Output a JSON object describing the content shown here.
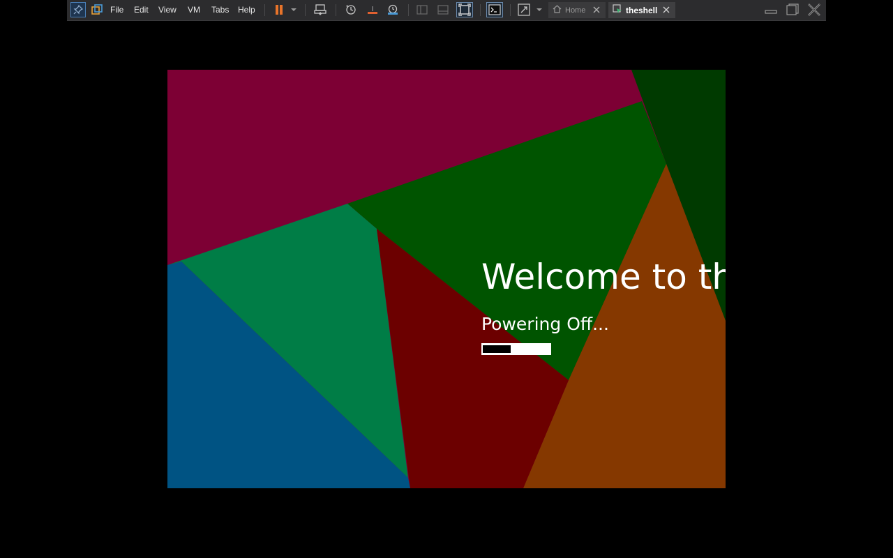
{
  "menu": {
    "file": "File",
    "edit": "Edit",
    "view": "View",
    "vm": "VM",
    "tabs": "Tabs",
    "help": "Help"
  },
  "icons": {
    "pin": "pin-icon",
    "library": "library-icon",
    "pause": "pause-icon",
    "send_keys": "send-ctrl-alt-del-icon",
    "snapshot": "snapshot-icon",
    "revert": "revert-snapshot-icon",
    "manage_snapshots": "snapshot-manager-icon",
    "console": "console-view-icon",
    "fullscreen": "fullscreen-icon"
  },
  "tabs": [
    {
      "label": "Home",
      "active": false
    },
    {
      "label": "theshell",
      "active": true
    }
  ],
  "vm_screen": {
    "welcome_text": "Welcome to th",
    "status_text": "Powering Off...",
    "progress_percent": 42
  },
  "colors": {
    "pause_accent": "#e8742a",
    "toolbar_bg": "#2c2c2e",
    "magenta": "#7d0034",
    "dark_green": "#005400",
    "darker_green": "#003a00",
    "teal_green": "#007d46",
    "blue": "#005383",
    "dark_red": "#6c0000",
    "orange": "#853800"
  }
}
